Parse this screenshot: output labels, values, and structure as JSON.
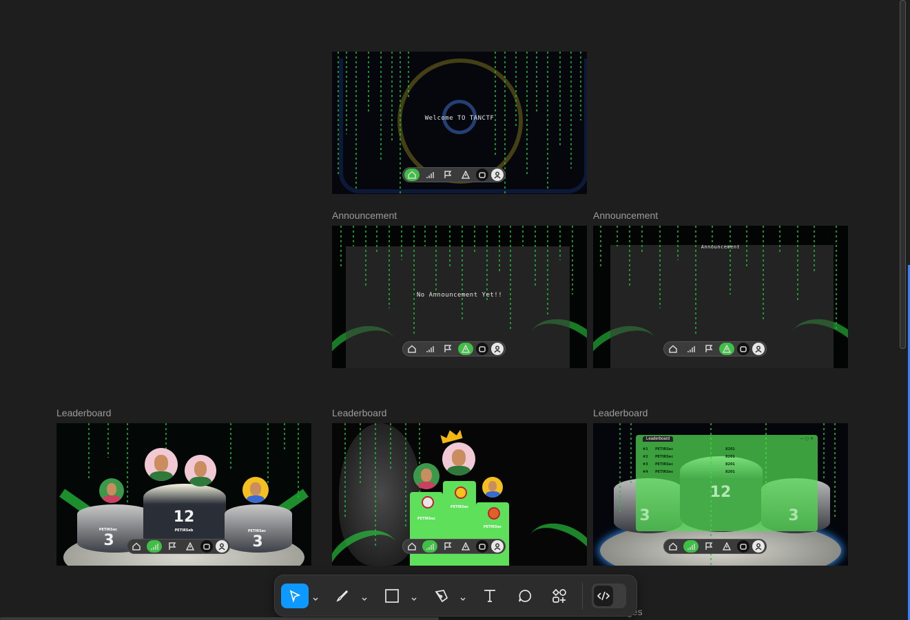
{
  "frames": {
    "home": {
      "label": "",
      "welcome": "Welcome TO TANCTF"
    },
    "announcement_empty": {
      "label": "Announcement",
      "message": "No Announcement Yet!!"
    },
    "announcement_list": {
      "label": "Announcement",
      "title": "Announcement"
    },
    "leaderboard_1": {
      "label": "Leaderboard",
      "first_score": "12",
      "first_name": "PETIRSeb",
      "second_score": "3",
      "second_name": "PETIRSec",
      "third_score": "3",
      "third_name": "PETIRSec"
    },
    "leaderboard_2": {
      "label": "Leaderboard",
      "name_left": "PETIRSec",
      "name_center": "PETIRSec",
      "name_right": "PETIRSec"
    },
    "leaderboard_3": {
      "label": "Leaderboard",
      "window_tab": "Leaderboard",
      "rows": [
        {
          "rank": "#1",
          "name": "PETIRSec",
          "score": "8201"
        },
        {
          "rank": "#2",
          "name": "PETIRSec",
          "score": "8201"
        },
        {
          "rank": "#3",
          "name": "PETIRSec",
          "score": "8201"
        },
        {
          "rank": "#4",
          "name": "PETIRSec",
          "score": "8201"
        }
      ],
      "score_center": "12",
      "score_left": "3",
      "score_right": "3"
    }
  },
  "partial_label": "ges",
  "toolbar": {
    "tools": [
      "move-tool",
      "pen-tool",
      "rectangle-tool",
      "vector-tool",
      "text-tool",
      "comment-tool",
      "components-tool",
      "dev-mode-toggle"
    ],
    "active_tool": "move-tool",
    "accent_color": "#0d99ff"
  },
  "colors": {
    "canvas": "#1e1e1e",
    "matrix_green": "#1fbf3a",
    "nav_active": "#3fbf46"
  }
}
